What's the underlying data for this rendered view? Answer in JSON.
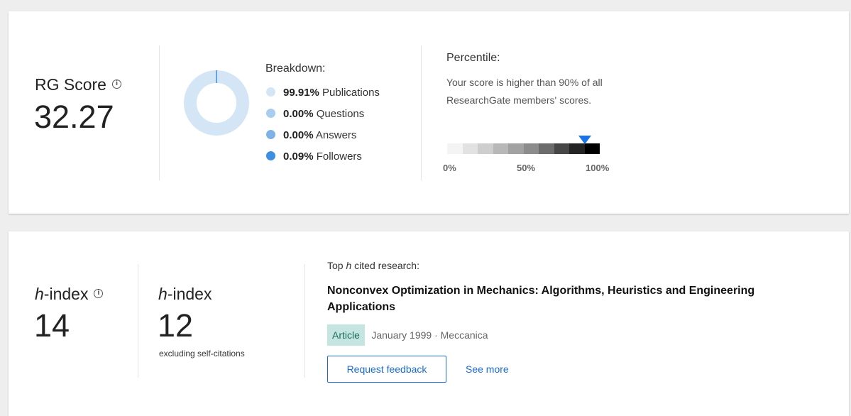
{
  "rg_score": {
    "label": "RG Score",
    "value": "32.27",
    "info_icon": "info-icon"
  },
  "breakdown": {
    "title": "Breakdown:",
    "items": [
      {
        "percent": "99.91%",
        "label": "Publications",
        "color": "#d4e6f6"
      },
      {
        "percent": "0.00%",
        "label": "Questions",
        "color": "#a9cdf0"
      },
      {
        "percent": "0.00%",
        "label": "Answers",
        "color": "#7fb3e8"
      },
      {
        "percent": "0.09%",
        "label": "Followers",
        "color": "#3d8fe0"
      }
    ],
    "donut_colors": {
      "ring": "#d4e6f6",
      "marker": "#3d8fe0"
    }
  },
  "percentile": {
    "title": "Percentile:",
    "text": "Your score is higher than 90% of all ResearchGate members' scores.",
    "value": 0.9,
    "marker_color": "#1a73e8",
    "tick_0": "0%",
    "tick_50": "50%",
    "tick_100": "100%"
  },
  "h_index": {
    "label_italic": "h",
    "label_suffix": "-index",
    "value": "14",
    "info_icon": "info-icon"
  },
  "h_index_excl": {
    "label_italic": "h",
    "label_suffix": "-index",
    "value": "12",
    "note": "excluding self-citations"
  },
  "top_research": {
    "title_prefix": "Top ",
    "title_italic": "h",
    "title_suffix": " cited research:",
    "paper_title": "Nonconvex Optimization in Mechanics: Algorithms, Heuristics and Engineering Applications",
    "badge": "Article",
    "meta": "January 1999 · Meccanica",
    "request_button": "Request feedback",
    "see_more": "See more"
  }
}
